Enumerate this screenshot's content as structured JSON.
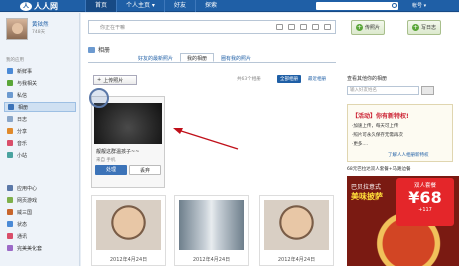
{
  "topbar": {
    "logo_text": "人人网",
    "nav": [
      "首页",
      "个人主页 ▾",
      "好友",
      "探索"
    ],
    "account": "帐号 ▾"
  },
  "sidebar": {
    "profile_name": "黄铉然",
    "profile_stat": "748天",
    "section_apps": "我的应用",
    "items": [
      {
        "label": "新鲜事",
        "color": "#4b8ad6"
      },
      {
        "label": "与我相关",
        "color": "#5aa639"
      },
      {
        "label": "私信",
        "color": "#6c9ad0"
      },
      {
        "label": "相册",
        "color": "#3c73b8"
      },
      {
        "label": "日志",
        "color": "#8aa6c8"
      },
      {
        "label": "分享",
        "color": "#e08a2c"
      },
      {
        "label": "音乐",
        "color": "#d94e6a"
      },
      {
        "label": "小站",
        "color": "#4aa3a0"
      }
    ],
    "section_more": "",
    "items2": [
      {
        "label": "应用中心",
        "color": "#5b78a8"
      },
      {
        "label": "网页游戏",
        "color": "#7fb04b"
      },
      {
        "label": "威三国",
        "color": "#c8652c"
      },
      {
        "label": "状态",
        "color": "#4b8ad6"
      },
      {
        "label": "通讯",
        "color": "#d94e6a"
      },
      {
        "label": "完美美化套",
        "color": "#9c6ac7"
      }
    ]
  },
  "composer": {
    "placeholder": "你正在干嘛",
    "btn_photo": "传照片",
    "btn_blog": "写日志"
  },
  "album_page": {
    "title": "相册",
    "tabs": [
      "好友的最新照片",
      "我的相册",
      "圈有我的照片"
    ],
    "active_tab": 1,
    "upload": "上传照片",
    "count_text": "共63个相册",
    "filter_all": "全部相册",
    "filter_recent": "最近相册"
  },
  "featured_album": {
    "title": "靓靓这群温孩子~~",
    "sub": "来自 手机",
    "btn_primary": "处理",
    "btn_secondary": "丢弃"
  },
  "photos": [
    {
      "date": "2012年4月24日",
      "kind": "face"
    },
    {
      "date": "2012年4月24日",
      "kind": "corridor"
    },
    {
      "date": "2012年4月24日",
      "kind": "face"
    }
  ],
  "right": {
    "search_title": "查看其他你的相册",
    "search_placeholder": "输入好友姓名",
    "promo_title": "【活动】你有新特权!",
    "promo_lines": [
      "·加速上传，每天可上传",
      "·照片可永久保存无需再次",
      "·更多...."
    ],
    "promo_link": "了解人人相册新特权",
    "ad_title": "68元巴拉达双人套餐+马路边餐",
    "ad_line1": "巴贝拉意式",
    "ad_line2": "美味披萨",
    "ad_badge_top": "双人套餐",
    "ad_badge_price": "¥68",
    "ad_badge_sub": "+117"
  }
}
